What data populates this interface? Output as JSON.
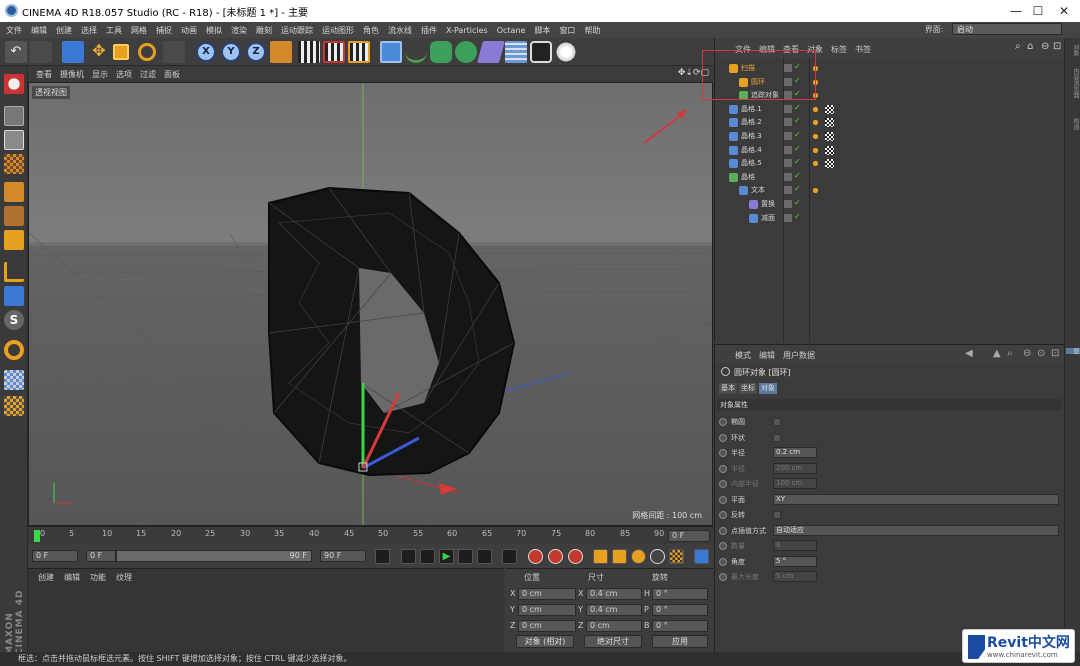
{
  "window": {
    "title": "CINEMA 4D R18.057 Studio (RC - R18) - [未标题 1 *] - 主要",
    "buttons": [
      "—",
      "☐",
      "✕"
    ]
  },
  "menubar": {
    "items": [
      "文件",
      "编辑",
      "创建",
      "选择",
      "工具",
      "网格",
      "捕捉",
      "动画",
      "模拟",
      "渲染",
      "雕刻",
      "运动跟踪",
      "运动图形",
      "角色",
      "流水线",
      "插件",
      "X-Particles",
      "Octane",
      "脚本",
      "窗口",
      "帮助"
    ],
    "layout_label": "界面:",
    "layout_value": "启动"
  },
  "toolbar": {
    "axis_buttons": [
      "X",
      "Y",
      "Z"
    ]
  },
  "viewport": {
    "menu": [
      "查看",
      "摄像机",
      "显示",
      "选项",
      "过滤",
      "面板"
    ],
    "view_label": "透视视图",
    "grid_spacing": "网格间距 : 100 cm"
  },
  "timeline": {
    "ticks": [
      "0",
      "5",
      "10",
      "15",
      "20",
      "25",
      "30",
      "35",
      "40",
      "45",
      "50",
      "55",
      "60",
      "65",
      "70",
      "75",
      "80",
      "85",
      "90"
    ],
    "current_frame": "0 F",
    "start_frame": "0 F",
    "range_start": "0 F",
    "range_end": "90 F",
    "end_frame": "90 F"
  },
  "material_panel": {
    "menu": [
      "创建",
      "编辑",
      "功能",
      "纹理"
    ],
    "brand": "MAXON CINEMA 4D"
  },
  "coordinates": {
    "headers": [
      "位置",
      "尺寸",
      "旋转"
    ],
    "rows": [
      {
        "axis": "X",
        "pos": "0 cm",
        "size_axis": "X",
        "size": "0.4 cm",
        "rot_axis": "H",
        "rot": "0 °"
      },
      {
        "axis": "Y",
        "pos": "0 cm",
        "size_axis": "Y",
        "size": "0.4 cm",
        "rot_axis": "P",
        "rot": "0 °"
      },
      {
        "axis": "Z",
        "pos": "0 cm",
        "size_axis": "Z",
        "size": "0 cm",
        "rot_axis": "B",
        "rot": "0 °"
      }
    ],
    "mode_select": "对象 (相对)",
    "size_select": "绝对尺寸",
    "apply_label": "应用"
  },
  "object_manager": {
    "menu": [
      "文件",
      "编辑",
      "查看",
      "对象",
      "标签",
      "书签"
    ],
    "objects": [
      {
        "name": "扫描",
        "indent": 0,
        "highlight": true
      },
      {
        "name": "圆环",
        "indent": 1,
        "highlight": true
      },
      {
        "name": "追踪对象",
        "indent": 1,
        "highlight": false
      },
      {
        "name": "晶格.1",
        "indent": 0,
        "highlight": false
      },
      {
        "name": "晶格.2",
        "indent": 0,
        "highlight": false
      },
      {
        "name": "晶格.3",
        "indent": 0,
        "highlight": false
      },
      {
        "name": "晶格.4",
        "indent": 0,
        "highlight": false
      },
      {
        "name": "晶格.5",
        "indent": 0,
        "highlight": false
      },
      {
        "name": "晶格",
        "indent": 0,
        "highlight": false
      },
      {
        "name": "文本",
        "indent": 1,
        "highlight": false
      },
      {
        "name": "置换",
        "indent": 2,
        "highlight": false
      },
      {
        "name": "减面",
        "indent": 2,
        "highlight": false
      }
    ]
  },
  "attribute_manager": {
    "menu": [
      "模式",
      "编辑",
      "用户数据"
    ],
    "object_title": "圆环对象 [圆环]",
    "tabs": [
      "基本",
      "坐标",
      "对象"
    ],
    "section": "对象属性",
    "fields": [
      {
        "label": "椭圆",
        "type": "check",
        "value": "",
        "enabled": true
      },
      {
        "label": "环状",
        "type": "check",
        "value": "",
        "enabled": true
      },
      {
        "label": "半径",
        "type": "field",
        "value": "0.2 cm",
        "enabled": true
      },
      {
        "label": "半径",
        "type": "field",
        "value": "200 cm",
        "enabled": false
      },
      {
        "label": "内部半径",
        "type": "field",
        "value": "100 cm",
        "enabled": false
      },
      {
        "label": "平面",
        "type": "select",
        "value": "XY",
        "enabled": true
      },
      {
        "label": "反转",
        "type": "check",
        "value": "",
        "enabled": true
      },
      {
        "label": "点插值方式",
        "type": "select",
        "value": "自动适应",
        "enabled": true
      },
      {
        "label": "数量",
        "type": "field",
        "value": "8",
        "enabled": false
      },
      {
        "label": "角度",
        "type": "field",
        "value": "5 °",
        "enabled": true
      },
      {
        "label": "最大长度",
        "type": "field",
        "value": "5 cm",
        "enabled": false
      }
    ]
  },
  "side_strip": [
    "对象",
    "内容浏览器",
    "构造",
    "层"
  ],
  "statusbar": {
    "text": "框选：点击并拖动鼠标框选元素。按住 SHIFT 键增加选择对象；按住 CTRL 键减少选择对象。"
  },
  "watermark": {
    "brand": "Revit中文网",
    "url": "www.chinarevit.com"
  },
  "colors": {
    "accent": "#d23a3a",
    "check_green": "#6fcf3e",
    "highlight_orange": "#e8a33a"
  }
}
